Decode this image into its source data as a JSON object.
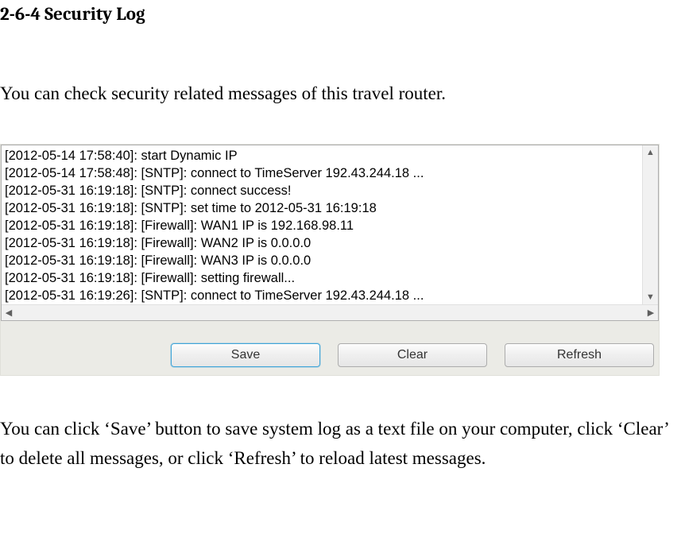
{
  "heading": "2-6-4 Security Log",
  "intro": "You can check security related messages of this travel router.",
  "log_lines": [
    "[2012-05-14 17:58:40]: start Dynamic IP",
    "[2012-05-14 17:58:48]: [SNTP]: connect to TimeServer 192.43.244.18 ...",
    "[2012-05-31 16:19:18]: [SNTP]: connect success!",
    "[2012-05-31 16:19:18]: [SNTP]: set time to 2012-05-31 16:19:18",
    "[2012-05-31 16:19:18]: [Firewall]: WAN1 IP is 192.168.98.11",
    "[2012-05-31 16:19:18]: [Firewall]: WAN2 IP is 0.0.0.0",
    "[2012-05-31 16:19:18]: [Firewall]: WAN3 IP is 0.0.0.0",
    "[2012-05-31 16:19:18]: [Firewall]: setting firewall...",
    "[2012-05-31 16:19:26]: [SNTP]: connect to TimeServer 192.43.244.18 ..."
  ],
  "buttons": {
    "save": "Save",
    "clear": "Clear",
    "refresh": "Refresh"
  },
  "outro": "You can click ‘Save’ button to save system log as a text file on your computer, click ‘Clear’ to delete all messages, or click ‘Refresh’ to reload latest messages.",
  "scroll_glyphs": {
    "up": "▲",
    "down": "▼",
    "left": "◀",
    "right": "▶"
  }
}
